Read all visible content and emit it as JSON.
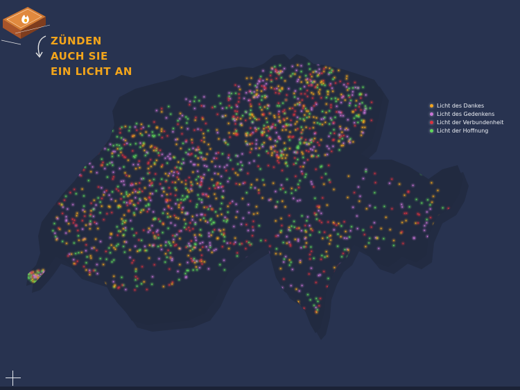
{
  "cta": {
    "line1": "Zünden auch sie",
    "line2": "ein Licht an",
    "icon": "matchbox-flame-icon"
  },
  "legend": {
    "items": [
      {
        "label": "Licht des Dankes",
        "color": "#f2a51f"
      },
      {
        "label": "Licht des Gedenkens",
        "color": "#c974d6"
      },
      {
        "label": "Licht der Verbundenheit",
        "color": "#d8333f"
      },
      {
        "label": "Licht der Hoffnung",
        "color": "#5fd85a"
      }
    ]
  },
  "colors": {
    "background": "#283350",
    "land": "#212a40",
    "land_shadow": "#3e4d72",
    "accent": "#f3a51b"
  },
  "footer": {
    "crosshair_icon": "crosshair-icon"
  }
}
